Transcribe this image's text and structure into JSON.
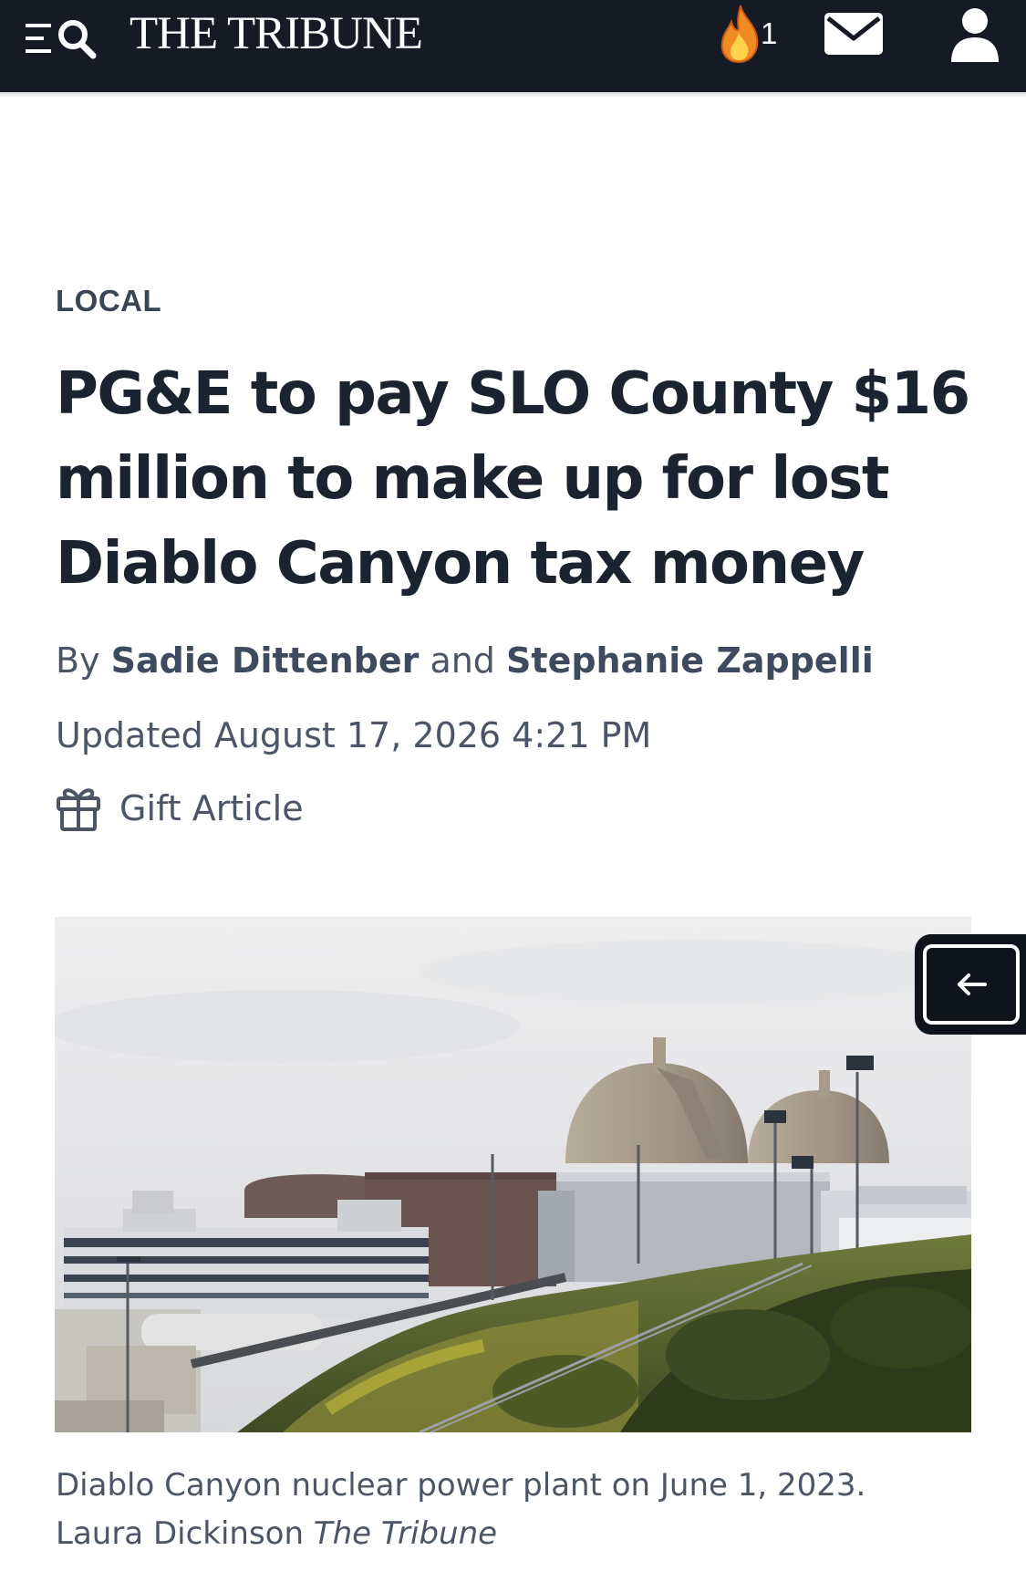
{
  "header": {
    "brand": "THE TRIBUNE",
    "streak_count": "1",
    "icons": {
      "menu": "menu-icon",
      "search": "search-icon",
      "streak": "flame-icon",
      "mail": "mail-icon",
      "account": "user-icon"
    },
    "colors": {
      "bar": "#151a25",
      "flame_outer": "#f08a24",
      "flame_inner": "#ffd24a"
    }
  },
  "article": {
    "section": "LOCAL",
    "headline": "PG&E to pay SLO County $16 million to make up for lost Diablo Canyon tax money",
    "byline": {
      "prefix": "By",
      "author1": "Sadie Dittenber",
      "conjunction": "and",
      "author2": "Stephanie Zappelli"
    },
    "updated": "Updated August 17, 2026 4:21 PM",
    "gift_label": "Gift Article",
    "gift_icon": "gift-icon"
  },
  "photo": {
    "caption": "Diablo Canyon nuclear power plant on June 1, 2023.",
    "credit_name": "Laura Dickinson",
    "credit_org": "The Tribune"
  },
  "side_tab": {
    "icon": "arrow-left-icon"
  }
}
